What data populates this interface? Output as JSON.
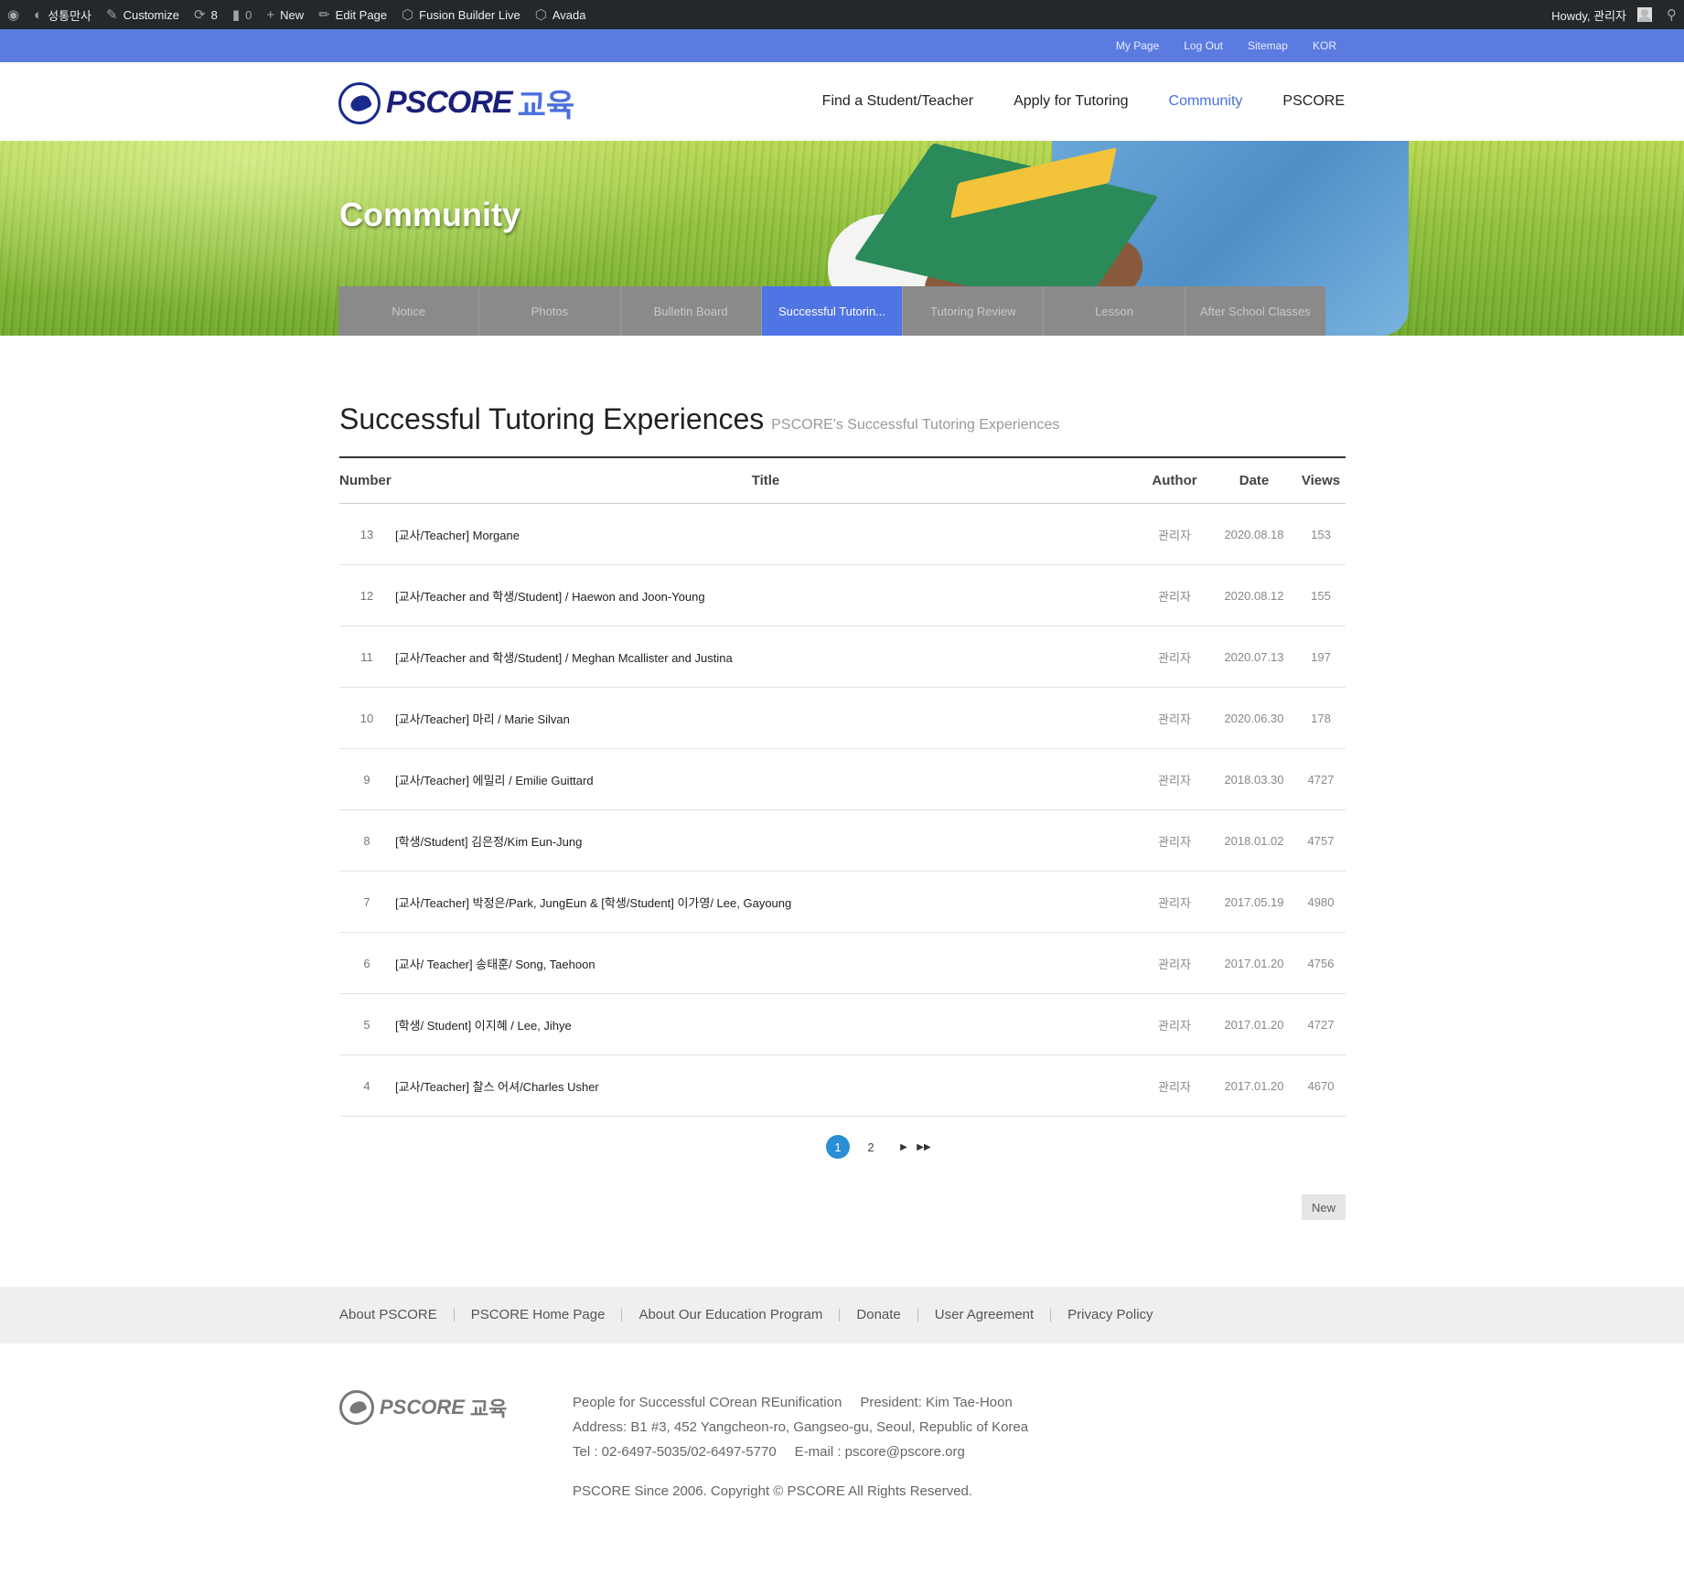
{
  "admin_bar": {
    "site_name": "성통만사",
    "customize": "Customize",
    "updates_count": "8",
    "comments_count": "0",
    "new": "New",
    "edit_page": "Edit Page",
    "fusion_builder": "Fusion Builder Live",
    "avada": "Avada",
    "howdy": "Howdy, 관리자"
  },
  "top_links": [
    "My Page",
    "Log Out",
    "Sitemap",
    "KOR"
  ],
  "logo": {
    "text": "PSCORE",
    "kr": "교육"
  },
  "main_nav": [
    {
      "label": "Find a Student/Teacher",
      "active": false
    },
    {
      "label": "Apply for Tutoring",
      "active": false
    },
    {
      "label": "Community",
      "active": true
    },
    {
      "label": "PSCORE",
      "active": false
    }
  ],
  "hero": {
    "title": "Community"
  },
  "sub_tabs": [
    {
      "label": "Notice",
      "active": false
    },
    {
      "label": "Photos",
      "active": false
    },
    {
      "label": "Bulletin Board",
      "active": false
    },
    {
      "label": "Successful Tutorin...",
      "active": true
    },
    {
      "label": "Tutoring Review",
      "active": false
    },
    {
      "label": "Lesson",
      "active": false
    },
    {
      "label": "After School Classes",
      "active": false
    }
  ],
  "page": {
    "title": "Successful Tutoring Experiences",
    "subtitle": "PSCORE's Successful Tutoring Experiences"
  },
  "board": {
    "columns": {
      "number": "Number",
      "title": "Title",
      "author": "Author",
      "date": "Date",
      "views": "Views"
    },
    "rows": [
      {
        "number": "13",
        "title": "[교사/Teacher] Morgane",
        "author": "관리자",
        "date": "2020.08.18",
        "views": "153"
      },
      {
        "number": "12",
        "title": "[교사/Teacher and 학생/Student] / Haewon and Joon-Young",
        "author": "관리자",
        "date": "2020.08.12",
        "views": "155"
      },
      {
        "number": "11",
        "title": "[교사/Teacher and 학생/Student] / Meghan Mcallister and Justina",
        "author": "관리자",
        "date": "2020.07.13",
        "views": "197"
      },
      {
        "number": "10",
        "title": "[교사/Teacher] 마리 / Marie Silvan",
        "author": "관리자",
        "date": "2020.06.30",
        "views": "178"
      },
      {
        "number": "9",
        "title": "[교사/Teacher] 에밀리 / Emilie Guittard",
        "author": "관리자",
        "date": "2018.03.30",
        "views": "4727"
      },
      {
        "number": "8",
        "title": "[학생/Student] 김은정/Kim Eun-Jung",
        "author": "관리자",
        "date": "2018.01.02",
        "views": "4757"
      },
      {
        "number": "7",
        "title": "[교사/Teacher] 박정은/Park, JungEun & [학생/Student] 이가영/ Lee, Gayoung",
        "author": "관리자",
        "date": "2017.05.19",
        "views": "4980"
      },
      {
        "number": "6",
        "title": "[교사/ Teacher] 송태훈/ Song, Taehoon",
        "author": "관리자",
        "date": "2017.01.20",
        "views": "4756"
      },
      {
        "number": "5",
        "title": "[학생/ Student] 이지혜 / Lee, Jihye",
        "author": "관리자",
        "date": "2017.01.20",
        "views": "4727"
      },
      {
        "number": "4",
        "title": "[교사/Teacher] 찰스 어셔/Charles Usher",
        "author": "관리자",
        "date": "2017.01.20",
        "views": "4670"
      }
    ]
  },
  "pagination": {
    "pages": [
      "1",
      "2"
    ],
    "current": "1"
  },
  "new_button": "New",
  "footer_links": [
    "About PSCORE",
    "PSCORE Home Page",
    "About Our Education Program",
    "Donate",
    "User Agreement",
    "Privacy Policy"
  ],
  "footer": {
    "logo_text": "PSCORE",
    "logo_kr": "교육",
    "org": "People for Successful COrean REunification",
    "president": "President: Kim Tae-Hoon",
    "address": "Address: B1 #3, 452 Yangcheon-ro, Gangseo-gu, Seoul, Republic of Korea",
    "tel": "Tel : 02-6497-5035/02-6497-5770",
    "email": "E-mail : pscore@pscore.org",
    "copyright": "PSCORE Since 2006. Copyright © PSCORE All Rights Reserved."
  },
  "colors": {
    "accent": "#4f74e3",
    "top_bar": "#5b7be0",
    "admin_bar": "#23282d"
  }
}
